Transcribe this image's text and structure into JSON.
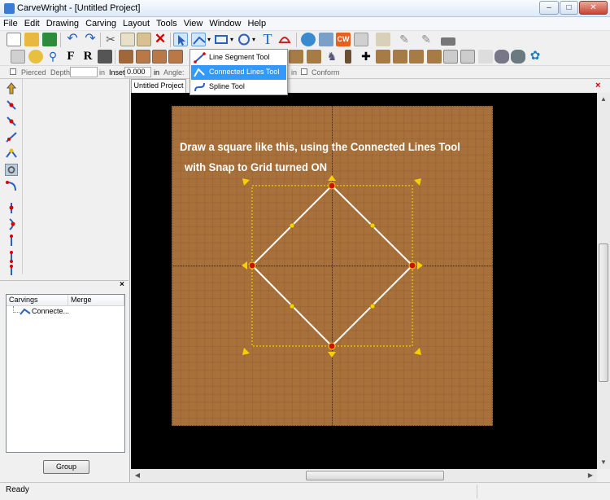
{
  "window": {
    "title": "CarveWright - [Untitled Project]",
    "min": "–",
    "max": "□",
    "close": "✕"
  },
  "menu": [
    "File",
    "Edit",
    "Drawing",
    "Carving",
    "Layout",
    "Tools",
    "View",
    "Window",
    "Help"
  ],
  "toolbar1": {
    "icons": [
      "new-icon",
      "open-icon",
      "save-icon",
      "undo-icon",
      "redo-icon",
      "cut-icon",
      "copy-icon",
      "paste-icon",
      "delete-icon",
      "select-icon",
      "line-tools-icon",
      "rectangle-icon",
      "circle-icon",
      "text-icon",
      "shell-icon",
      "clipart-icon",
      "machine-icon",
      "cw-icon",
      "pattern-icon",
      "fence-icon",
      "pen-icon",
      "brush-icon",
      "table-icon"
    ],
    "cw_label": "CW"
  },
  "toolbar2": {
    "labels": [
      "F",
      "R"
    ]
  },
  "propsbar": {
    "pierced": "Pierced",
    "depth_label": "Depth:",
    "depth_value": "",
    "depth_unit": "in",
    "inset_label": "Inset:",
    "inset_value": "0.000",
    "inset_unit": "in",
    "angle_label": "Angle:",
    "angle_unit": "in",
    "conform": "Conform"
  },
  "dropdown": {
    "items": [
      "Line Segment Tool",
      "Connected Lines Tool",
      "Spline Tool"
    ],
    "selected": "Connected Lines Tool"
  },
  "tab": {
    "label": "Untitled Project",
    "close": "×"
  },
  "leftpane": {
    "close": "×",
    "columns": [
      "Carvings",
      "Merge"
    ],
    "tree_item": "Connecte...",
    "group_button": "Group"
  },
  "canvas": {
    "instruction_line1": "Draw a square like this, using the Connected Lines Tool",
    "instruction_line2": "with Snap to Grid turned ON",
    "board_color": "#a8703a",
    "selection_color": "#f5d000",
    "line_color": "#ffffff",
    "handle_color": "#cc1100"
  },
  "status": {
    "text": "Ready"
  }
}
